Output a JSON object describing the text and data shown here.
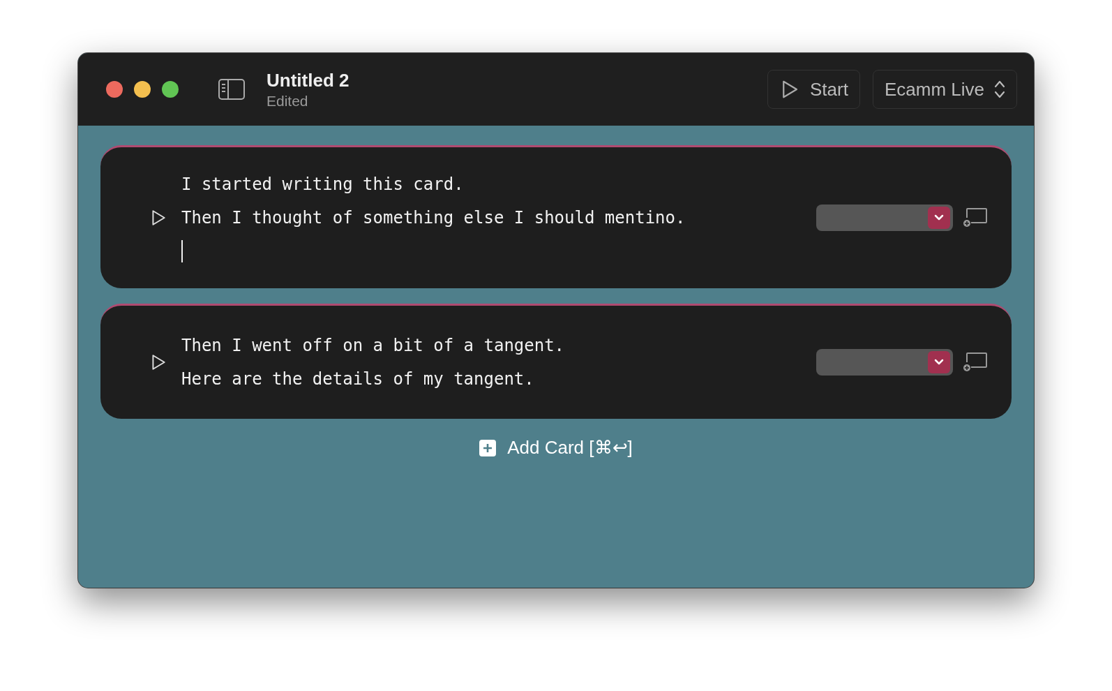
{
  "window": {
    "title": "Untitled 2",
    "subtitle": "Edited"
  },
  "toolbar": {
    "start_label": "Start",
    "destination": "Ecamm Live"
  },
  "cards": [
    {
      "lines": [
        "I started writing this card.",
        "Then I thought of something else I should mentino."
      ],
      "caret": true
    },
    {
      "lines": [
        "Then I went off on a bit of a tangent.",
        "Here are the details of my tangent."
      ],
      "caret": false
    }
  ],
  "add_card": {
    "label": "Add Card [⌘↩]"
  }
}
